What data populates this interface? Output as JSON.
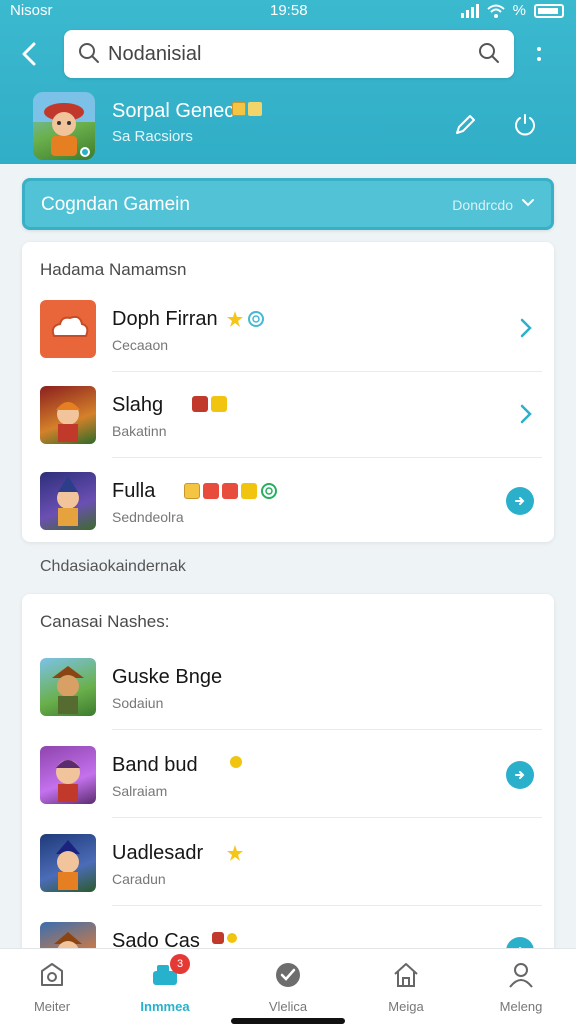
{
  "status_bar": {
    "carrier": "Nisosr",
    "time": "19:58",
    "battery": "%"
  },
  "search": {
    "value": "Nodanisial"
  },
  "profile": {
    "title": "Sorpal Genec",
    "subtitle": "Sa Racsiors"
  },
  "dropdown": {
    "label": "Cogndan Gamein",
    "value": "Dondrcdo"
  },
  "section1": {
    "title": "Hadama Namamsn",
    "items": [
      {
        "title": "Doph Firran",
        "subtitle": "Cecaaon",
        "action": "chevron"
      },
      {
        "title": "Slahg",
        "subtitle": "Bakatinn",
        "action": "chevron"
      },
      {
        "title": "Fulla",
        "subtitle": "Sedndeolra",
        "action": "arrow"
      }
    ]
  },
  "section_label": "Chdasiaokaindernak",
  "section2": {
    "title": "Canasai Nashes:",
    "items": [
      {
        "title": "Guske Bnge",
        "subtitle": "Sodaiun",
        "action": "none"
      },
      {
        "title": "Band bud",
        "subtitle": "Salraiam",
        "action": "arrow"
      },
      {
        "title": "Uadlesadr",
        "subtitle": "Caradun",
        "action": "none"
      },
      {
        "title": "Sado Cas",
        "subtitle": "",
        "action": "arrow"
      }
    ]
  },
  "nav": {
    "items": [
      {
        "label": "Meiter",
        "icon": "home-badge-icon"
      },
      {
        "label": "Inmmea",
        "icon": "games-icon"
      },
      {
        "label": "Vlelica",
        "icon": "check-circle-icon"
      },
      {
        "label": "Meiga",
        "icon": "house-icon"
      },
      {
        "label": "Meleng",
        "icon": "person-icon"
      }
    ],
    "badge": "3"
  },
  "colors": {
    "accent": "#2bb0cc",
    "header": "#3bb9cf",
    "badge": "#e53935"
  }
}
